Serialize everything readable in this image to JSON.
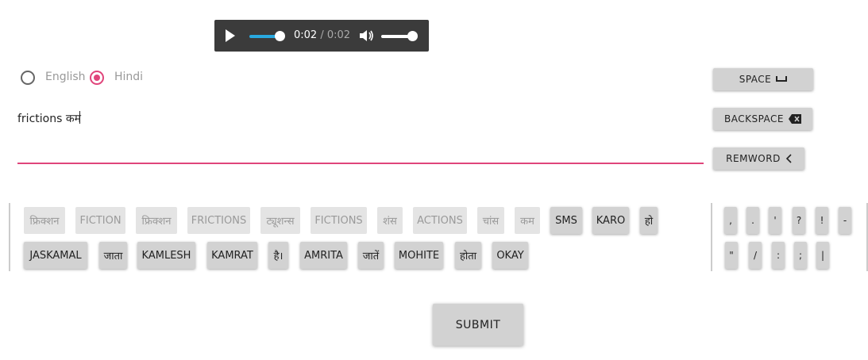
{
  "player": {
    "current_time": "0:02",
    "total_time": "/ 0:02",
    "progress": 1.0,
    "volume": 1.0
  },
  "language": {
    "options": [
      "English",
      "Hindi"
    ],
    "selected": "Hindi"
  },
  "input": {
    "value": "frictions कम"
  },
  "actions": {
    "space": "SPACE",
    "backspace": "BACKSPACE",
    "remword": "REMWORD"
  },
  "suggestions_row1": [
    {
      "label": "फ्रिक्शन",
      "enabled": false
    },
    {
      "label": "FICTION",
      "enabled": false
    },
    {
      "label": "फ्रिक्शन",
      "enabled": false
    },
    {
      "label": "FRICTIONS",
      "enabled": false
    },
    {
      "label": "ट्यूशन्स",
      "enabled": false
    },
    {
      "label": "FICTIONS",
      "enabled": false
    },
    {
      "label": "शंस",
      "enabled": false
    },
    {
      "label": "ACTIONS",
      "enabled": false
    },
    {
      "label": "चांस",
      "enabled": false
    },
    {
      "label": "कम",
      "enabled": false
    },
    {
      "label": "SMS",
      "enabled": true
    },
    {
      "label": "KARO",
      "enabled": true
    },
    {
      "label": "हो",
      "enabled": true
    }
  ],
  "suggestions_row2": [
    {
      "label": "JASKAMAL",
      "enabled": true
    },
    {
      "label": "जाता",
      "enabled": true
    },
    {
      "label": "KAMLESH",
      "enabled": true
    },
    {
      "label": "KAMRAT",
      "enabled": true
    },
    {
      "label": "है।",
      "enabled": true
    },
    {
      "label": "AMRITA",
      "enabled": true
    },
    {
      "label": "जातें",
      "enabled": true
    },
    {
      "label": "MOHITE",
      "enabled": true
    },
    {
      "label": "होता",
      "enabled": true
    },
    {
      "label": "OKAY",
      "enabled": true
    }
  ],
  "punctuation_row1": [
    ",",
    ".",
    "'",
    "?",
    "!",
    "-"
  ],
  "punctuation_row2": [
    "\"",
    "/",
    ":",
    ";",
    "|"
  ],
  "submit": "SUBMIT",
  "colors": {
    "accent": "#e0457b",
    "player_bg": "#3b3b3b",
    "progress": "#29a9e0",
    "button": "#d2d2d2"
  }
}
